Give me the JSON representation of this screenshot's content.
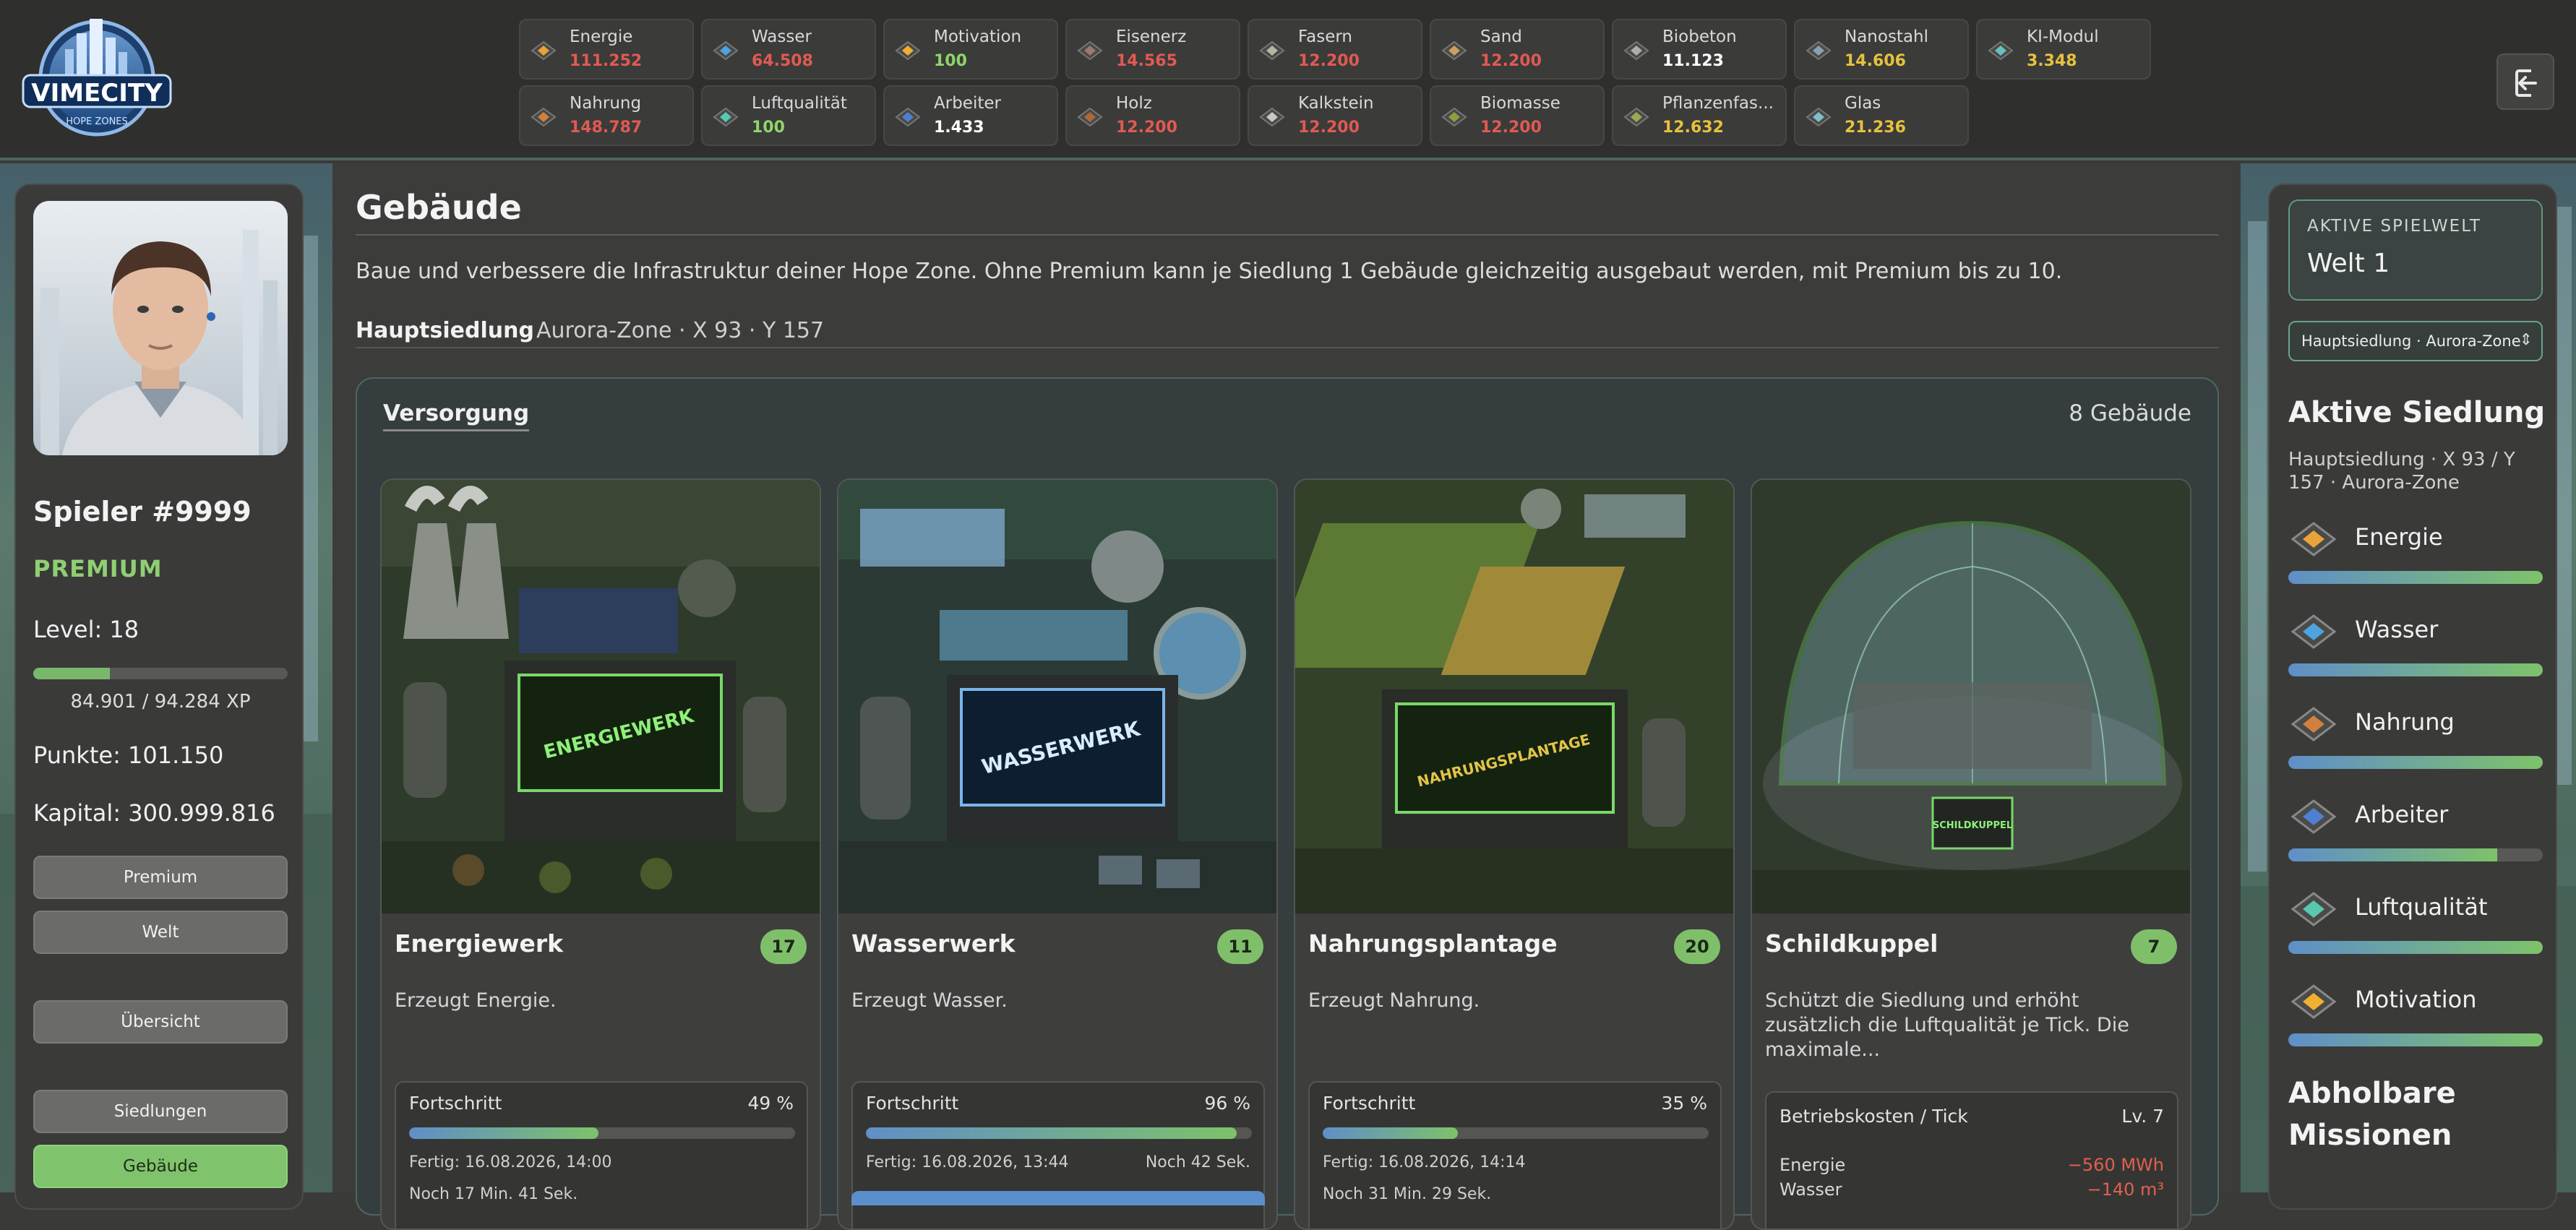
{
  "app": {
    "logo_text": "VIMECITY",
    "logo_subtext": "HOPE ZONES"
  },
  "colors": {
    "accent_green": "#7fc46c",
    "value_red": "#e05a52",
    "value_yellow": "#e6c23c",
    "value_white": "#ffffff",
    "value_green": "#8fd56c",
    "border_teal": "#5e9a80"
  },
  "resources": [
    {
      "name": "Energie",
      "value": "111.252",
      "status": "red",
      "icon": "energy-crystal-icon"
    },
    {
      "name": "Wasser",
      "value": "64.508",
      "status": "red",
      "icon": "water-crystal-icon"
    },
    {
      "name": "Motivation",
      "value": "100",
      "status": "green",
      "icon": "motivation-crystal-icon"
    },
    {
      "name": "Eisenerz",
      "value": "14.565",
      "status": "red",
      "icon": "iron-ore-icon"
    },
    {
      "name": "Fasern",
      "value": "12.200",
      "status": "red",
      "icon": "fiber-icon"
    },
    {
      "name": "Sand",
      "value": "12.200",
      "status": "red",
      "icon": "sand-icon"
    },
    {
      "name": "Biobeton",
      "value": "11.123",
      "status": "white",
      "icon": "biobeton-icon"
    },
    {
      "name": "Nanostahl",
      "value": "14.606",
      "status": "yellow",
      "icon": "nanosteel-icon"
    },
    {
      "name": "KI-Modul",
      "value": "3.348",
      "status": "yellow",
      "icon": "ai-module-icon"
    },
    {
      "name": "Nahrung",
      "value": "148.787",
      "status": "red",
      "icon": "food-crystal-icon"
    },
    {
      "name": "Luftqualität",
      "value": "100",
      "status": "green",
      "icon": "air-quality-icon"
    },
    {
      "name": "Arbeiter",
      "value": "1.433",
      "status": "white",
      "icon": "worker-crystal-icon"
    },
    {
      "name": "Holz",
      "value": "12.200",
      "status": "red",
      "icon": "wood-icon"
    },
    {
      "name": "Kalkstein",
      "value": "12.200",
      "status": "red",
      "icon": "limestone-icon"
    },
    {
      "name": "Biomasse",
      "value": "12.200",
      "status": "red",
      "icon": "biomass-icon"
    },
    {
      "name": "Pflanzenfas...",
      "value": "12.632",
      "status": "yellow",
      "icon": "plant-fiber-icon"
    },
    {
      "name": "Glas",
      "value": "21.236",
      "status": "yellow",
      "icon": "glass-icon"
    }
  ],
  "player": {
    "name": "Spieler #9999",
    "premium": "PREMIUM",
    "level": "Level: 18",
    "xp_fraction": 0.3,
    "xp_text": "84.901 / 94.284 XP",
    "points": "Punkte: 101.150",
    "capital": "Kapital: 300.999.816"
  },
  "nav": {
    "premium": "Premium",
    "welt": "Welt",
    "uebersicht": "Übersicht",
    "siedlungen": "Siedlungen",
    "gebaeude": "Gebäude"
  },
  "page": {
    "title": "Gebäude",
    "description": "Baue und verbessere die Infrastruktur deiner Hope Zone. Ohne Premium kann je Siedlung 1 Gebäude gleichzeitig ausgebaut werden, mit Premium bis zu 10.",
    "settlement_name": "Hauptsiedlung",
    "settlement_info": "Aurora-Zone · X 93 · Y 157"
  },
  "section": {
    "title": "Versorgung",
    "count": "8 Gebäude"
  },
  "buildings": [
    {
      "name": "Energiewerk",
      "level": "17",
      "desc": "Erzeugt Energie.",
      "sign": "ENERGIEWERK",
      "progress_label": "Fortschritt",
      "progress_text": "49 %",
      "progress": 0.49,
      "done": "Fertig: 16.08.2026, 14:00",
      "remaining": "Noch 17 Min. 41 Sek."
    },
    {
      "name": "Wasserwerk",
      "level": "11",
      "desc": "Erzeugt Wasser.",
      "sign": "WASSERWERK",
      "progress_label": "Fortschritt",
      "progress_text": "96 %",
      "progress": 0.96,
      "done": "Fertig: 16.08.2026, 13:44",
      "remaining": "Noch 42 Sek."
    },
    {
      "name": "Nahrungsplantage",
      "level": "20",
      "desc": "Erzeugt Nahrung.",
      "sign": "NAHRUNGSPLANTAGE",
      "progress_label": "Fortschritt",
      "progress_text": "35 %",
      "progress": 0.35,
      "done": "Fertig: 16.08.2026, 14:14",
      "remaining": "Noch 31 Min. 29 Sek."
    },
    {
      "name": "Schildkuppel",
      "level": "7",
      "desc": "Schützt die Siedlung und erhöht zusätzlich die Luftqualität je Tick. Die maximale...",
      "sign": "SCHILDKUPPEL",
      "cost_label": "Betriebskosten / Tick",
      "cost_level": "Lv. 7",
      "costs": [
        {
          "name": "Energie",
          "value": "−560 MWh"
        },
        {
          "name": "Wasser",
          "value": "−140 m³"
        }
      ]
    }
  ],
  "right": {
    "world_label": "AKTIVE SPIELWELT",
    "world_value": "Welt 1",
    "settlement_select": "Hauptsiedlung · Aurora-Zone",
    "active_title": "Aktive Siedlung",
    "active_info": "Hauptsiedlung · X 93 / Y 157 · Aurora-Zone",
    "stats": [
      {
        "name": "Energie",
        "fill": 1.0,
        "icon": "energy-crystal-icon"
      },
      {
        "name": "Wasser",
        "fill": 1.0,
        "icon": "water-crystal-icon"
      },
      {
        "name": "Nahrung",
        "fill": 1.0,
        "icon": "food-crystal-icon"
      },
      {
        "name": "Arbeiter",
        "fill": 0.82,
        "icon": "worker-crystal-icon"
      },
      {
        "name": "Luftqualität",
        "fill": 1.0,
        "icon": "air-quality-icon"
      },
      {
        "name": "Motivation",
        "fill": 1.0,
        "icon": "motivation-crystal-icon"
      }
    ],
    "missions_title": "Abholbare Missionen"
  }
}
